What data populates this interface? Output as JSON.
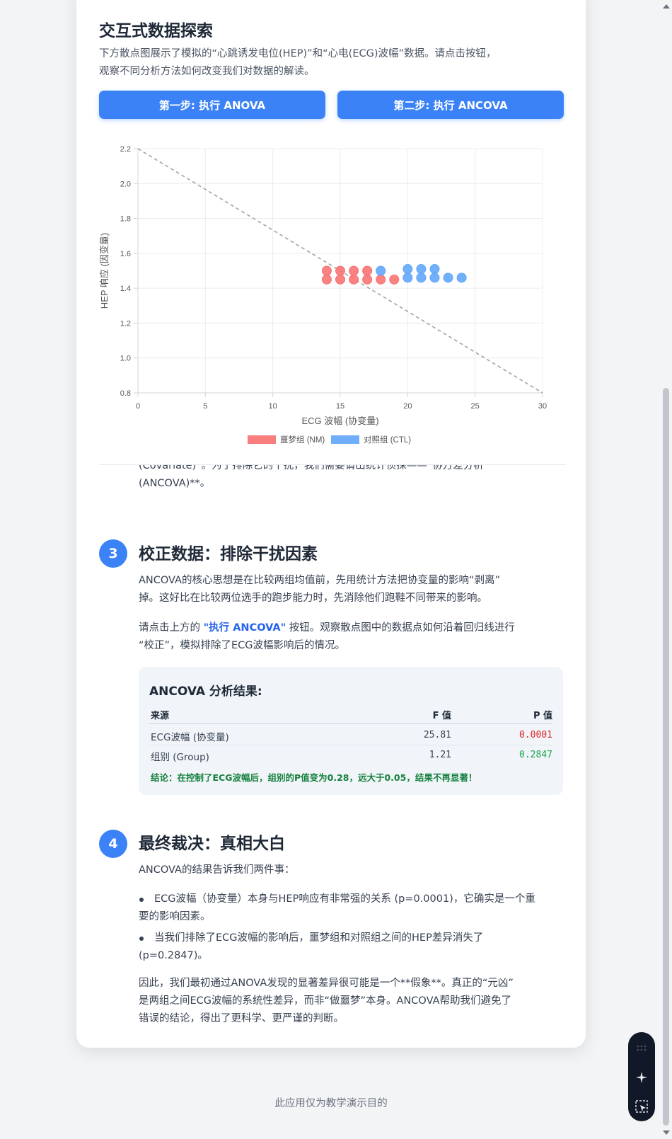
{
  "section_interactive": {
    "title": "交互式数据探索",
    "description_line1": "下方散点图展示了模拟的“心跳诱发电位(HEP)”和“心电(ECG)波幅”数据。请点击按钮，",
    "description_line2": "观察不同分析方法如何改变我们对数据的解读。",
    "btn_anova": "第一步: 执行 ANOVA",
    "btn_ancova": "第二步: 执行 ANCOVA"
  },
  "chart_data": {
    "type": "scatter",
    "xlabel": "ECG 波幅 (协变量)",
    "ylabel": "HEP 响应 (因变量)",
    "xlim": [
      0,
      30
    ],
    "ylim": [
      0.8,
      2.2
    ],
    "x_ticks": [
      "0",
      "5",
      "10",
      "15",
      "20",
      "25",
      "30"
    ],
    "y_ticks": [
      "0.8",
      "1.0",
      "1.2",
      "1.4",
      "1.6",
      "1.8",
      "2.0",
      "2.2"
    ],
    "grid": true,
    "legend_position": "bottom",
    "regression_line": {
      "x": [
        0,
        30
      ],
      "y": [
        2.2,
        0.8
      ],
      "style": "dashed",
      "color": "#a3a3a3"
    },
    "series": [
      {
        "name": "噩梦组 (NM)",
        "color": "#f87171",
        "points": [
          {
            "x": 14,
            "y": 1.5
          },
          {
            "x": 15,
            "y": 1.5
          },
          {
            "x": 16,
            "y": 1.5
          },
          {
            "x": 17,
            "y": 1.5
          },
          {
            "x": 14,
            "y": 1.45
          },
          {
            "x": 15,
            "y": 1.45
          },
          {
            "x": 16,
            "y": 1.45
          },
          {
            "x": 17,
            "y": 1.45
          },
          {
            "x": 18,
            "y": 1.45
          },
          {
            "x": 19,
            "y": 1.45
          }
        ]
      },
      {
        "name": "对照组 (CTL)",
        "color": "#60a5fa",
        "points": [
          {
            "x": 18,
            "y": 1.5
          },
          {
            "x": 20,
            "y": 1.51
          },
          {
            "x": 21,
            "y": 1.51
          },
          {
            "x": 22,
            "y": 1.51
          },
          {
            "x": 20,
            "y": 1.46
          },
          {
            "x": 21,
            "y": 1.46
          },
          {
            "x": 22,
            "y": 1.46
          },
          {
            "x": 23,
            "y": 1.46
          },
          {
            "x": 24,
            "y": 1.46
          }
        ]
      }
    ]
  },
  "cut_text": {
    "line1": "(Covariate)”。为了排除它的干扰，我们需要请出统计侦探——“协方差分析",
    "line2": "(ANCOVA)**。"
  },
  "step3": {
    "number": "3",
    "title": "校正数据：排除干扰因素",
    "p1_line1": "ANCOVA的核心思想是在比较两组均值前，先用统计方法把协变量的影响“剥离”",
    "p1_line2": "掉。这好比在比较两位选手的跑步能力时，先消除他们跑鞋不同带来的影响。",
    "p2_pre": "请点击上方的 ",
    "p2_highlight": "\"执行 ANCOVA\"",
    "p2_post": " 按钮。观察散点图中的数据点如何沿着回归线进行",
    "p2_line2": "“校正”，模拟排除了ECG波幅影响后的情况。",
    "result": {
      "title": "ANCOVA 分析结果:",
      "headers": [
        "来源",
        "F 值",
        "P 值"
      ],
      "rows": [
        {
          "source": "ECG波幅 (协变量)",
          "f": "25.81",
          "p": "0.0001",
          "p_color": "#dc2626"
        },
        {
          "source": "组别 (Group)",
          "f": "1.21",
          "p": "0.2847",
          "p_color": "#16a34a"
        }
      ],
      "conclusion": "结论：在控制了ECG波幅后，组别的P值变为0.28，远大于0.05，结果不再显著！"
    }
  },
  "step4": {
    "number": "4",
    "title": "最终裁决：真相大白",
    "intro": "ANCOVA的结果告诉我们两件事：",
    "bullet1_line1": "ECG波幅（协变量）本身与HEP响应有非常强的关系 (p=0.0001)，它确实是一个重",
    "bullet1_line2": "要的影响因素。",
    "bullet2_line1": "当我们排除了ECG波幅的影响后，噩梦组和对照组之间的HEP差异消失了",
    "bullet2_line2": "(p=0.2847)。",
    "final_line1": "因此，我们最初通过ANOVA发现的显著差异很可能是一个**假象**。真正的“元凶”",
    "final_line2": "是两组之间ECG波幅的系统性差异，而非“做噩梦”本身。ANCOVA帮助我们避免了",
    "final_line3": "错误的结论，得出了更科学、更严谨的判断。"
  },
  "footer": {
    "text": "此应用仅为教学演示目的"
  },
  "floating_toolbar": {
    "icons": [
      "grip-icon",
      "sparkle-icon",
      "select-icon"
    ]
  }
}
